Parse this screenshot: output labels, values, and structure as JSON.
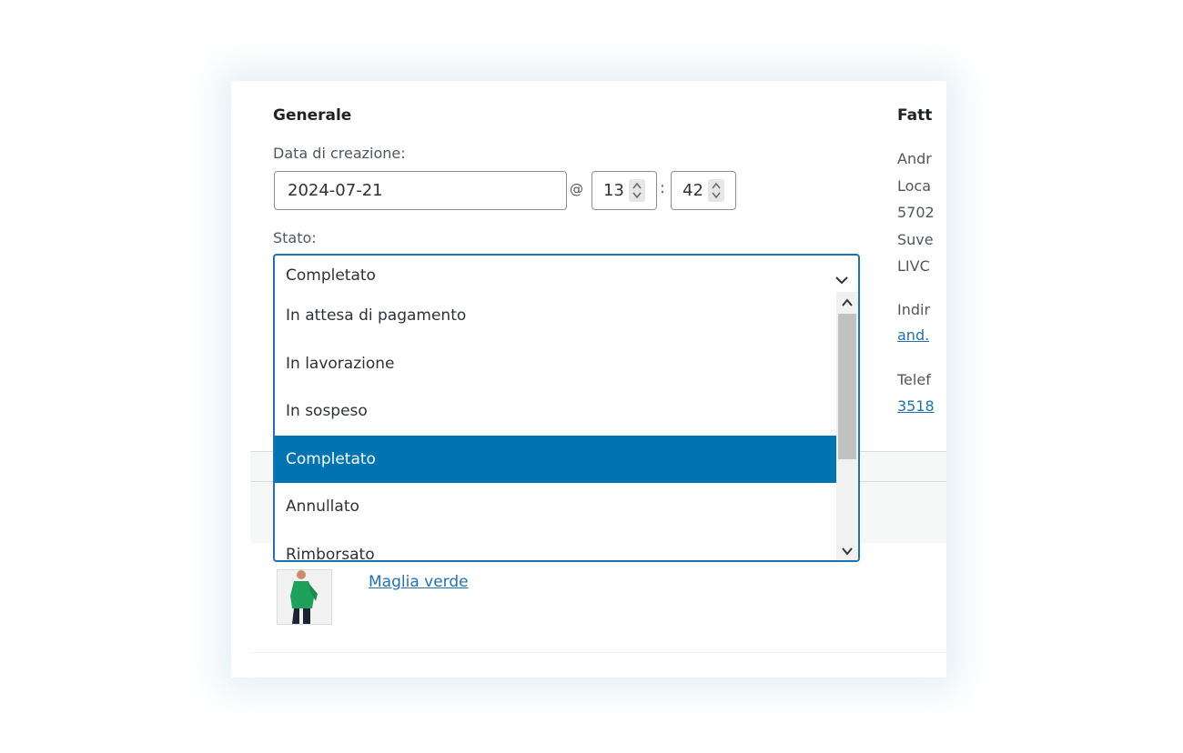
{
  "general": {
    "title": "Generale",
    "date_label": "Data di creazione:",
    "date_value": "2024-07-21",
    "at_sign": "@",
    "hour_value": "13",
    "time_separator": ":",
    "minute_value": "42",
    "status_label": "Stato:"
  },
  "status_select": {
    "selected": "Completato",
    "options": [
      {
        "label": "In attesa di pagamento",
        "selected": false
      },
      {
        "label": "In lavorazione",
        "selected": false
      },
      {
        "label": "In sospeso",
        "selected": false
      },
      {
        "label": "Completato",
        "selected": true
      },
      {
        "label": "Annullato",
        "selected": false
      },
      {
        "label": "Rimborsato",
        "selected": false
      }
    ]
  },
  "billing": {
    "title": "Fatt",
    "address_lines": [
      "Andr",
      "Loca",
      "5702",
      "Suve",
      "LIVC"
    ],
    "email_label": "Indir",
    "email_value": "and.",
    "phone_label": "Telef",
    "phone_value": "3518"
  },
  "product": {
    "name": "Maglia verde"
  },
  "colors": {
    "accent": "#2271b1",
    "selected_option_bg": "#0073b3"
  }
}
